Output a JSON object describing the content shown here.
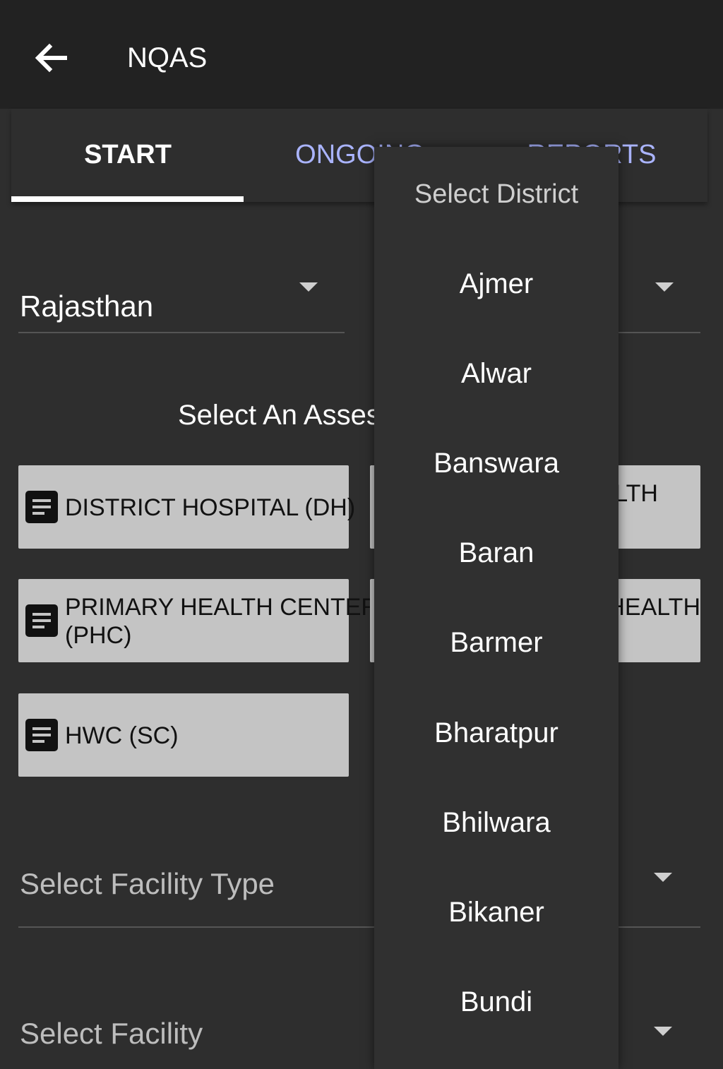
{
  "app": {
    "title": "NQAS"
  },
  "tabs": [
    {
      "label": "START",
      "active": true
    },
    {
      "label": "ONGOING",
      "active": false
    },
    {
      "label": "REPORTS",
      "active": false
    }
  ],
  "state_spinner": {
    "value": "Rajasthan"
  },
  "section_title": "Select An Assessment",
  "assessment_cards": [
    {
      "label": "DISTRICT HOSPITAL (DH)"
    },
    {
      "label": "PRIMARY HEALTH CENTER",
      "label2": "(PHC)"
    },
    {
      "label": "HWC (SC)"
    },
    {
      "label": "LTH"
    },
    {
      "label": "HEALTH"
    }
  ],
  "facility_type": {
    "placeholder": "Select Facility Type"
  },
  "facility": {
    "placeholder": "Select Facility"
  },
  "district_dropdown": {
    "title": "Select District",
    "options": [
      "Ajmer",
      "Alwar",
      "Banswara",
      "Baran",
      "Barmer",
      "Bharatpur",
      "Bhilwara",
      "Bikaner",
      "Bundi"
    ]
  },
  "colors": {
    "tab_inactive": "#aab4ff",
    "card_bg": "#c4c4c4",
    "appbar_bg": "#222222",
    "body_bg": "#2e2e2e"
  },
  "icons": {
    "back": "arrow-left-icon",
    "card": "document-icon",
    "caret": "caret-down-icon"
  }
}
